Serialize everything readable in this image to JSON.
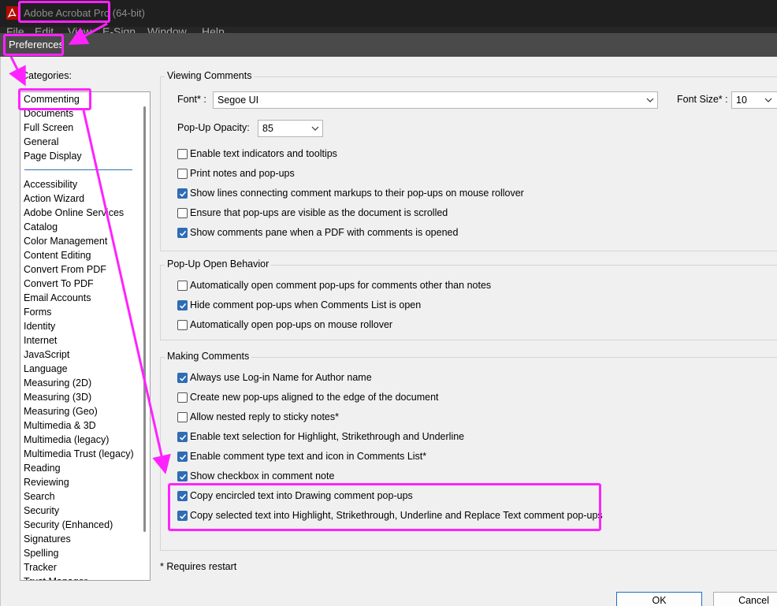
{
  "app": {
    "title": "Adobe Acrobat Pro (64-bit)",
    "menu": [
      "File",
      "Edit",
      "View",
      "E-Sign",
      "Window",
      "Help"
    ]
  },
  "dialog": {
    "title": "Preferences",
    "categories_label": "Categories:",
    "categories_top": [
      "Commenting",
      "Documents",
      "Full Screen",
      "General",
      "Page Display"
    ],
    "categories_rest": [
      "Accessibility",
      "Action Wizard",
      "Adobe Online Services",
      "Catalog",
      "Color Management",
      "Content Editing",
      "Convert From PDF",
      "Convert To PDF",
      "Email Accounts",
      "Forms",
      "Identity",
      "Internet",
      "JavaScript",
      "Language",
      "Measuring (2D)",
      "Measuring (3D)",
      "Measuring (Geo)",
      "Multimedia & 3D",
      "Multimedia (legacy)",
      "Multimedia Trust (legacy)",
      "Reading",
      "Reviewing",
      "Search",
      "Security",
      "Security (Enhanced)",
      "Signatures",
      "Spelling",
      "Tracker",
      "Trust Manager"
    ],
    "selected_category": "Commenting"
  },
  "viewing": {
    "title": "Viewing Comments",
    "font_label": "Font* :",
    "font_value": "Segoe UI",
    "font_size_label": "Font Size* :",
    "font_size_value": "10",
    "opacity_label": "Pop-Up Opacity:",
    "opacity_value": "85",
    "options": [
      {
        "label": "Enable text indicators and tooltips",
        "checked": false
      },
      {
        "label": "Print notes and pop-ups",
        "checked": false
      },
      {
        "label": "Show lines connecting comment markups to their pop-ups on mouse rollover",
        "checked": true
      },
      {
        "label": "Ensure that pop-ups are visible as the document is scrolled",
        "checked": false
      },
      {
        "label": "Show comments pane when a PDF with comments is opened",
        "checked": true
      }
    ]
  },
  "popup": {
    "title": "Pop-Up Open Behavior",
    "options": [
      {
        "label": "Automatically open comment pop-ups for comments other than notes",
        "checked": false
      },
      {
        "label": "Hide comment pop-ups when Comments List is open",
        "checked": true
      },
      {
        "label": "Automatically open pop-ups on mouse rollover",
        "checked": false
      }
    ]
  },
  "making": {
    "title": "Making Comments",
    "options": [
      {
        "label": "Always use Log-in Name for Author name",
        "checked": true
      },
      {
        "label": "Create new pop-ups aligned to the edge of the document",
        "checked": false
      },
      {
        "label": "Allow nested reply to sticky notes*",
        "checked": false
      },
      {
        "label": "Enable text selection for Highlight, Strikethrough and Underline",
        "checked": true
      },
      {
        "label": "Enable comment type text and icon in Comments List*",
        "checked": true
      },
      {
        "label": "Show checkbox in comment note",
        "checked": true
      },
      {
        "label": "Copy encircled text into Drawing comment pop-ups",
        "checked": true
      },
      {
        "label": "Copy selected text into Highlight, Strikethrough, Underline and Replace Text comment pop-ups",
        "checked": true
      }
    ]
  },
  "footer": {
    "note": "* Requires restart",
    "ok_label": "OK",
    "cancel_label": "Cancel"
  },
  "colors": {
    "annotation": "#ff22ff",
    "checkbox_checked": "#2f6cb5",
    "titlebar": "#1f1f1f",
    "dialog_titlebar": "#4a4a4a"
  },
  "icons": [
    "acrobat-logo-icon",
    "chevron-down-icon",
    "checkmark-icon"
  ]
}
